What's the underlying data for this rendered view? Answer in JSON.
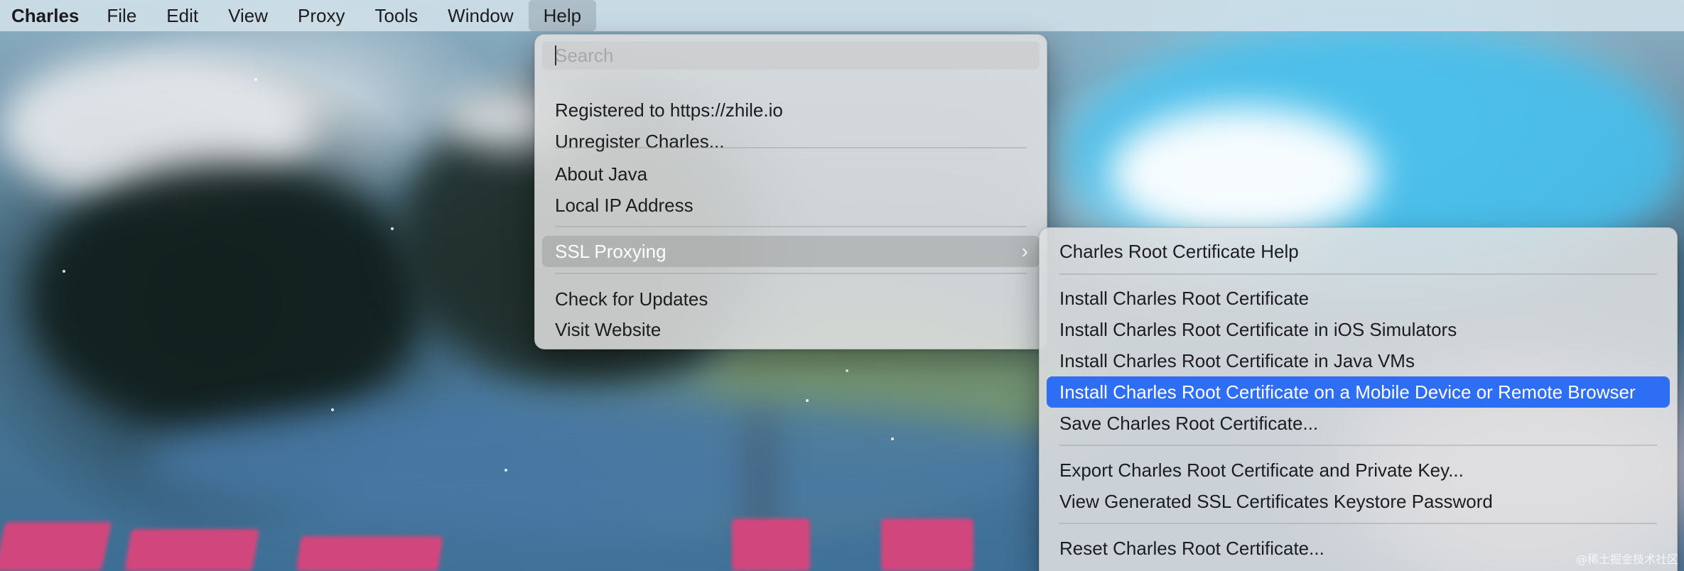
{
  "menubar": {
    "app_name": "Charles",
    "items": [
      "File",
      "Edit",
      "View",
      "Proxy",
      "Tools",
      "Window",
      "Help"
    ],
    "active_item": "Help"
  },
  "help_menu": {
    "search_placeholder": "Search",
    "items": [
      "Registered to https://zhile.io",
      "Unregister Charles...",
      "About Java",
      "Local IP Address",
      "SSL Proxying",
      "Check for Updates",
      "Visit Website"
    ],
    "highlighted_item": "SSL Proxying",
    "submenu_arrow_icon": "chevron-right-icon"
  },
  "ssl_submenu": {
    "items": [
      "Charles Root Certificate Help",
      "Install Charles Root Certificate",
      "Install Charles Root Certificate in iOS Simulators",
      "Install Charles Root Certificate in Java VMs",
      "Install Charles Root Certificate on a Mobile Device or Remote Browser",
      "Save Charles Root Certificate...",
      "Export Charles Root Certificate and Private Key...",
      "View Generated SSL Certificates Keystore Password",
      "Reset Charles Root Certificate..."
    ],
    "highlighted_item": "Install Charles Root Certificate on a Mobile Device or Remote Browser"
  },
  "watermark": "@稀土掘金技术社区",
  "colors": {
    "highlight_blue": "#2e6ef5",
    "menubar_bg": "#d6e4ec"
  }
}
